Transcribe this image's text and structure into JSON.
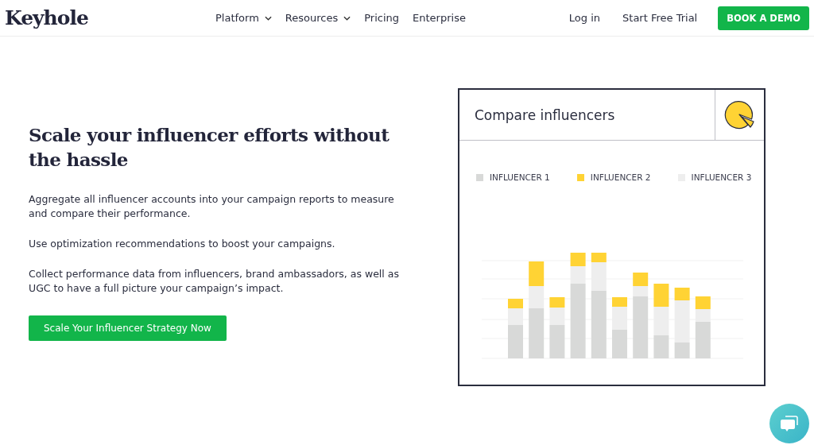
{
  "header": {
    "logo": "Keyhole",
    "nav": [
      {
        "label": "Platform",
        "dropdown": true
      },
      {
        "label": "Resources",
        "dropdown": true
      },
      {
        "label": "Pricing",
        "dropdown": false
      },
      {
        "label": "Enterprise",
        "dropdown": false
      }
    ],
    "login": "Log in",
    "trial": "Start Free Trial",
    "demo": "BOOK A DEMO"
  },
  "hero": {
    "heading": "Scale your influencer efforts without the hassle",
    "paragraphs": [
      "Aggregate all influencer accounts into your campaign reports to measure and compare their performance.",
      "Use optimization recommendations to boost your campaigns.",
      "Collect performance data from influencers, brand ambassadors, as well as UGC to have a full picture your campaign’s impact."
    ],
    "cta": "Scale Your Influencer Strategy Now"
  },
  "card": {
    "title": "Compare influencers",
    "legend": [
      {
        "label": "INFLUENCER 1",
        "color": "#d8d9d8"
      },
      {
        "label": "INFLUENCER 2",
        "color": "#ffd334"
      },
      {
        "label": "INFLUENCER 3",
        "color": "#eeeeee"
      }
    ]
  }
}
